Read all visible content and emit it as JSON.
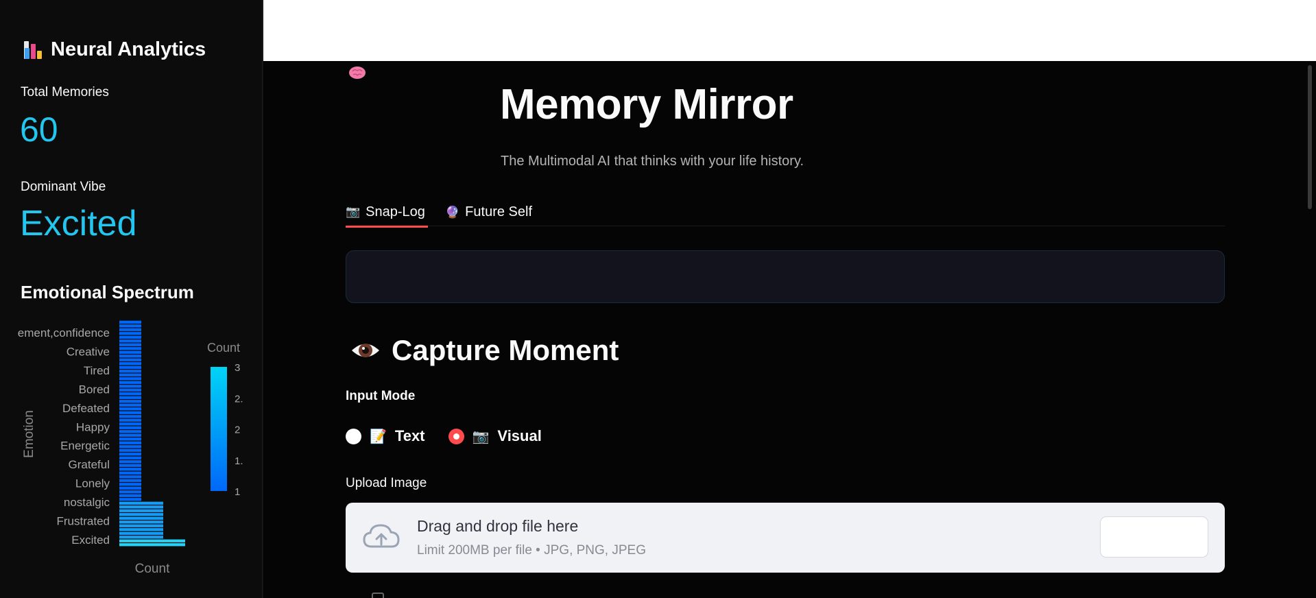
{
  "sidebar": {
    "title": "Neural Analytics",
    "title_icon": "bar-chart-icon",
    "metrics": [
      {
        "label": "Total Memories",
        "value": "60"
      },
      {
        "label": "Dominant Vibe",
        "value": "Excited"
      }
    ],
    "section_title": "Emotional Spectrum"
  },
  "chart_data": {
    "type": "bar",
    "orientation": "horizontal",
    "ylabel": "Emotion",
    "xlabel": "Count",
    "colorbar_title": "Count",
    "colorbar_ticks": [
      "3",
      "2.",
      "2",
      "1.",
      "1"
    ],
    "visible_labels": [
      "ement,confidence",
      "Creative",
      "Tired",
      "Bored",
      "Defeated",
      "Happy",
      "Energetic",
      "Grateful",
      "Lonely",
      "nostalgic",
      "Frustrated",
      "Excited"
    ],
    "bar_counts": [
      1,
      1,
      1,
      1,
      1,
      1,
      1,
      1,
      1,
      1,
      1,
      1,
      1,
      1,
      1,
      1,
      1,
      1,
      1,
      1,
      1,
      1,
      1,
      1,
      1,
      1,
      1,
      1,
      1,
      1,
      1,
      1,
      1,
      1,
      1,
      1,
      1,
      1,
      1,
      1,
      1,
      1,
      1,
      1,
      1,
      1,
      1,
      1,
      2,
      2,
      2,
      2,
      2,
      2,
      2,
      2,
      2,
      2,
      3,
      3
    ],
    "colors": {
      "low": "#0068f9",
      "high": "#29d0f2"
    }
  },
  "header": {
    "logo_icon": "brain-icon",
    "title": "Memory Mirror",
    "subtitle": "The Multimodal AI that thinks with your life history."
  },
  "tabs": [
    {
      "label": "Snap-Log",
      "icon": "📷",
      "active": true
    },
    {
      "label": "Future Self",
      "icon": "🔮",
      "active": false
    }
  ],
  "capture": {
    "title": "Capture Moment",
    "icon": "eye-icon",
    "input_mode_label": "Input Mode",
    "options": [
      {
        "label": "Text",
        "icon": "📝",
        "selected": false
      },
      {
        "label": "Visual",
        "icon": "📷",
        "selected": true
      }
    ],
    "upload_label": "Upload Image",
    "dropzone_title": "Drag and drop file here",
    "dropzone_sub": "Limit 200MB per file • JPG, PNG, JPEG"
  },
  "colors": {
    "accent": "#ff4b4b",
    "metric": "#22c6ee"
  }
}
